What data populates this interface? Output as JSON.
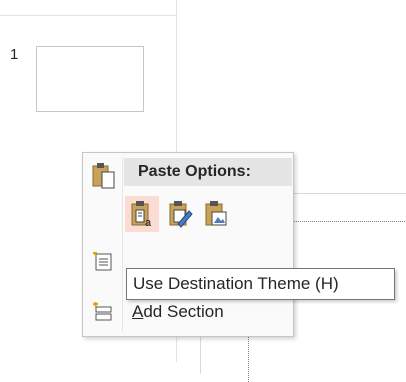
{
  "thumbnail_pane": {
    "slide_number": "1"
  },
  "context_menu": {
    "paste_options_label": "Paste Options:",
    "paste_options": [
      {
        "icon": "paste-keep-destination-theme-icon",
        "active": true
      },
      {
        "icon": "paste-keep-source-formatting-icon",
        "active": false
      },
      {
        "icon": "paste-picture-icon",
        "active": false
      }
    ],
    "items": [
      {
        "icon": "new-slide-icon",
        "label": ""
      },
      {
        "icon": "add-section-icon",
        "label_accel": "A",
        "label_rest": "dd Section"
      }
    ]
  },
  "tooltip": {
    "text": "Use Destination Theme (H)"
  },
  "colors": {
    "active_option_bg": "#fbdcd5",
    "header_bg": "#e5e5e5",
    "menu_bg": "#fafafa"
  }
}
